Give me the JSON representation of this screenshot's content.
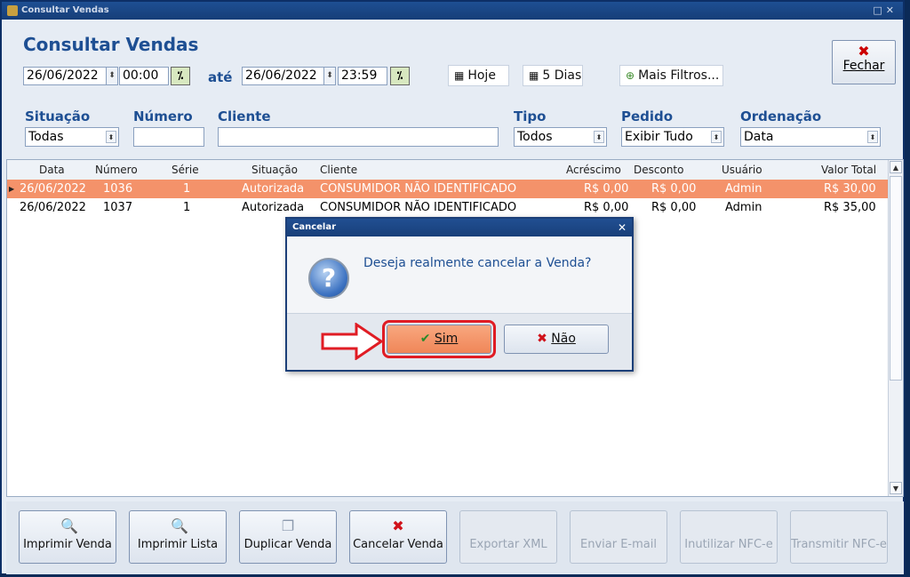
{
  "window": {
    "title": "Consultar Vendas"
  },
  "header": {
    "page_title": "Consultar Vendas",
    "date_from": "26/06/2022",
    "time_from": "00:00",
    "until_label": "até",
    "date_to": "26/06/2022",
    "time_to": "23:59",
    "btn_hoje": "Hoje",
    "btn_5dias": "5 Dias",
    "btn_mais_filtros": "Mais Filtros...",
    "btn_fechar": "Fechar"
  },
  "filters": {
    "situacao_label": "Situação",
    "situacao_value": "Todas",
    "numero_label": "Número",
    "numero_value": "",
    "cliente_label": "Cliente",
    "cliente_value": "",
    "tipo_label": "Tipo",
    "tipo_value": "Todos",
    "pedido_label": "Pedido",
    "pedido_value": "Exibir Tudo",
    "ordenacao_label": "Ordenação",
    "ordenacao_value": "Data"
  },
  "table": {
    "columns": [
      "Data",
      "Número",
      "Série",
      "Situação",
      "Cliente",
      "Acréscimo",
      "Desconto",
      "Usuário",
      "Valor Total"
    ],
    "rows": [
      [
        "26/06/2022",
        "1036",
        "1",
        "Autorizada",
        "CONSUMIDOR NÃO IDENTIFICADO",
        "R$ 0,00",
        "R$ 0,00",
        "Admin",
        "R$ 30,00"
      ],
      [
        "26/06/2022",
        "1037",
        "1",
        "Autorizada",
        "CONSUMIDOR NÃO IDENTIFICADO",
        "R$ 0,00",
        "R$ 0,00",
        "Admin",
        "R$ 35,00"
      ]
    ]
  },
  "actions": {
    "imprimir_venda": "Imprimir Venda",
    "imprimir_lista": "Imprimir Lista",
    "duplicar_venda": "Duplicar Venda",
    "cancelar_venda": "Cancelar Venda",
    "exportar_xml": "Exportar XML",
    "enviar_email": "Enviar E-mail",
    "inutilizar_nfce": "Inutilizar NFC-e",
    "transmitir_nfce": "Transmitir NFC-e"
  },
  "dialog": {
    "title": "Cancelar",
    "message": "Deseja realmente cancelar a Venda?",
    "yes_label": "Sim",
    "no_label": "Não"
  },
  "colors": {
    "accent": "#1e4f93",
    "selected_row": "#f4926a",
    "highlight": "#e01c24"
  }
}
